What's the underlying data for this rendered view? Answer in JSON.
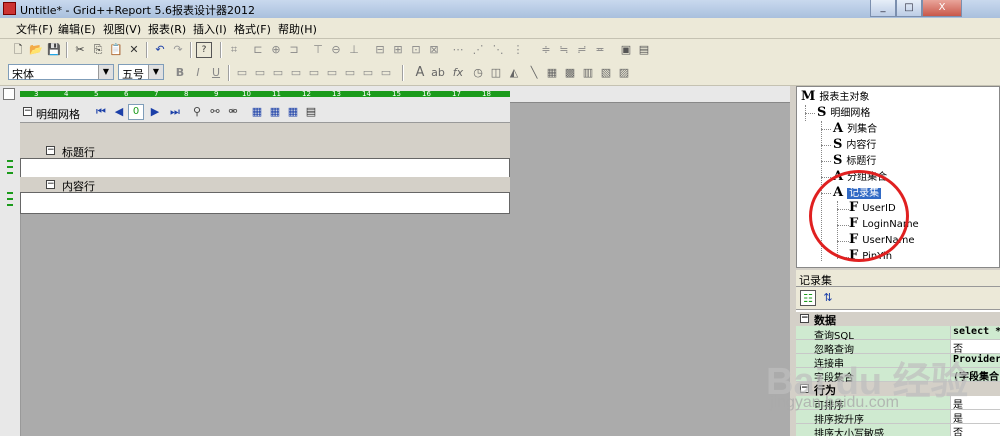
{
  "window": {
    "title": "Untitle* - Grid++Report 5.6报表设计器2012",
    "controls": [
      "_",
      "□",
      "X"
    ]
  },
  "menubar": {
    "items": [
      {
        "label": "文件(F)"
      },
      {
        "label": "编辑(E)"
      },
      {
        "label": "视图(V)"
      },
      {
        "label": "报表(R)"
      },
      {
        "label": "插入(I)"
      },
      {
        "label": "格式(F)"
      },
      {
        "label": "帮助(H)"
      }
    ]
  },
  "format_toolbar": {
    "font_name": "宋体",
    "font_size": "五号",
    "bold": "B",
    "italic": "I",
    "underline": "U"
  },
  "design": {
    "ruler_numbers": [
      "3",
      "4",
      "5",
      "6",
      "7",
      "8",
      "9",
      "10",
      "11",
      "12",
      "13",
      "14",
      "15",
      "16",
      "17",
      "18"
    ],
    "grid_title": "明细网格",
    "page_number": "0",
    "title_section": "标题行",
    "content_section": "内容行"
  },
  "tree": {
    "nodes": [
      {
        "glyph": "M",
        "label": "报表主对象"
      },
      {
        "glyph": "S",
        "label": "明细网格"
      },
      {
        "glyph": "A",
        "label": "列集合"
      },
      {
        "glyph": "S",
        "label": "内容行"
      },
      {
        "glyph": "S",
        "label": "标题行"
      },
      {
        "glyph": "A",
        "label": "分组集合"
      },
      {
        "glyph": "A",
        "label": "记录集"
      },
      {
        "glyph": "F",
        "label": "UserID"
      },
      {
        "glyph": "F",
        "label": "LoginName"
      },
      {
        "glyph": "F",
        "label": "UserName"
      },
      {
        "glyph": "F",
        "label": "PinYin"
      }
    ]
  },
  "properties": {
    "panel_title": "记录集",
    "categories": [
      {
        "label": "数据"
      },
      {
        "label": "行为"
      }
    ],
    "rows": [
      {
        "name": "查询SQL",
        "value": "select *"
      },
      {
        "name": "忽略查询",
        "value": "否"
      },
      {
        "name": "连接串",
        "value": "Provider="
      },
      {
        "name": "字段集合",
        "value": "(字段集合)"
      },
      {
        "name": "可排序",
        "value": "是"
      },
      {
        "name": "排序按升序",
        "value": "是"
      },
      {
        "name": "排序大小写敏感",
        "value": "否"
      }
    ]
  },
  "watermark": {
    "brand": "Bai du 经验",
    "url": "jingyan.baidu.com"
  },
  "colors": {
    "accent": "#316ac5",
    "ruler_green": "#1b9b1b",
    "annotation_red": "#e02020"
  }
}
